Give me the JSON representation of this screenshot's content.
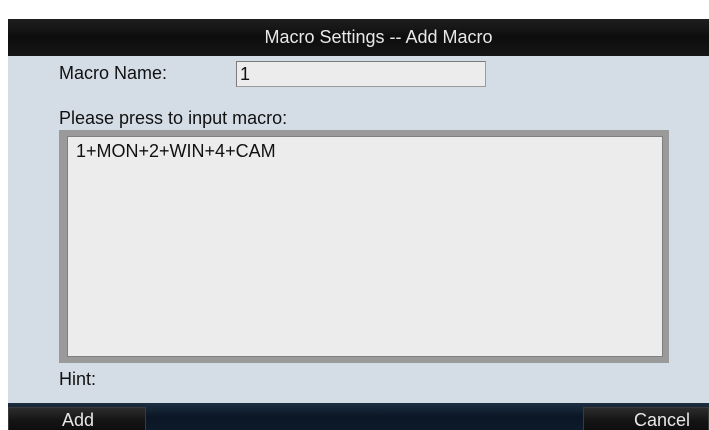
{
  "dialog": {
    "title": "Macro Settings -- Add Macro",
    "macro_name_label": "Macro Name:",
    "macro_name_value": "1",
    "prompt_label": "Please press to input macro:",
    "macro_sequence": "1+MON+2+WIN+4+CAM",
    "hint_label": "Hint:"
  },
  "buttons": {
    "add_label": "Add",
    "cancel_label": "Cancel"
  },
  "colors": {
    "dialog_background": "#d4dde6",
    "title_bar": "#111111",
    "bottom_bar": "#0b1726",
    "field_background": "#ececec",
    "frame": "#9a9a9a"
  }
}
